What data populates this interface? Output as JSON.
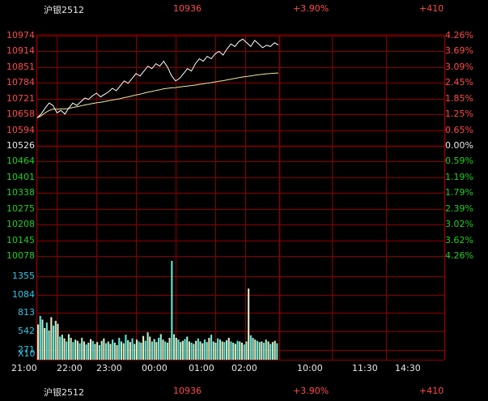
{
  "header_top": {
    "symbol": "沪银2512",
    "price": "10936",
    "change_pct": "+3.90%",
    "change_abs": "+410"
  },
  "header_bottom": {
    "symbol": "沪银2512",
    "price": "10936",
    "change_pct": "+3.90%",
    "change_abs": "+410"
  },
  "price_axis_left": [
    "10974",
    "10914",
    "10851",
    "10784",
    "10721",
    "10658",
    "10594",
    "10526",
    "10464",
    "10401",
    "10338",
    "10275",
    "10208",
    "10145",
    "10078"
  ],
  "price_axis_right": [
    "4.26%",
    "3.69%",
    "3.09%",
    "2.45%",
    "1.85%",
    "1.25%",
    "0.65%",
    "0.00%",
    "0.59%",
    "1.19%",
    "1.79%",
    "2.39%",
    "3.02%",
    "3.62%",
    "4.26%"
  ],
  "volume_axis": [
    "1355",
    "1084",
    "813",
    "542",
    "271"
  ],
  "volume_unit": "X10",
  "time_axis": [
    "21:00",
    "22:00",
    "23:00",
    "00:00",
    "01:00",
    "02:00",
    "10:00",
    "11:30",
    "14:30"
  ],
  "colors": {
    "background": "#000000",
    "grid": "#8b0000",
    "up": "#ff4b4b",
    "down": "#20d020",
    "neutral": "#e8e8e8",
    "volume_axis": "#2ec8e8",
    "price_line": "#ffffff",
    "avg_line": "#f0e6a0"
  },
  "chart_data": {
    "type": "line",
    "base_price": 10526,
    "ylim": [
      10078,
      10974
    ],
    "price_series": {
      "values": [
        10640,
        10655,
        10680,
        10700,
        10690,
        10660,
        10670,
        10655,
        10680,
        10700,
        10690,
        10705,
        10720,
        10715,
        10730,
        10740,
        10725,
        10735,
        10745,
        10760,
        10750,
        10770,
        10790,
        10780,
        10800,
        10820,
        10810,
        10830,
        10850,
        10840,
        10860,
        10850,
        10870,
        10845,
        10810,
        10790,
        10800,
        10820,
        10840,
        10830,
        10860,
        10880,
        10870,
        10890,
        10880,
        10900,
        10910,
        10895,
        10920,
        10940,
        10930,
        10950,
        10960,
        10945,
        10930,
        10955,
        10940,
        10925,
        10935,
        10930,
        10945,
        10936
      ]
    },
    "avg_series": {
      "values": [
        10640,
        10648,
        10660,
        10670,
        10675,
        10675,
        10676,
        10676,
        10678,
        10682,
        10685,
        10688,
        10692,
        10695,
        10698,
        10701,
        10703,
        10706,
        10709,
        10712,
        10715,
        10718,
        10722,
        10725,
        10729,
        10733,
        10736,
        10740,
        10744,
        10747,
        10751,
        10754,
        10758,
        10760,
        10762,
        10763,
        10765,
        10767,
        10769,
        10771,
        10773,
        10776,
        10778,
        10781,
        10783,
        10786,
        10789,
        10791,
        10794,
        10797,
        10800,
        10803,
        10806,
        10808,
        10810,
        10813,
        10815,
        10817,
        10819,
        10820,
        10821,
        10822
      ]
    },
    "volume_series": {
      "values": [
        580,
        720,
        660,
        520,
        610,
        480,
        700,
        560,
        640,
        590,
        380,
        410,
        350,
        300,
        420,
        360,
        290,
        330,
        310,
        270,
        360,
        300,
        250,
        280,
        340,
        310,
        260,
        290,
        240,
        310,
        350,
        270,
        300,
        260,
        330,
        280,
        240,
        360,
        300,
        270,
        410,
        320,
        290,
        350,
        260,
        330,
        300,
        280,
        390,
        310,
        450,
        380,
        300,
        340,
        290,
        360,
        420,
        330,
        300,
        280,
        360,
        1650,
        420,
        360,
        330,
        290,
        310,
        340,
        380,
        300,
        280,
        260,
        310,
        350,
        300,
        270,
        330,
        290,
        360,
        410,
        300,
        280,
        350,
        330,
        300,
        290,
        320,
        360,
        300,
        280,
        260,
        310,
        300,
        280,
        250,
        300,
        1170,
        400,
        360,
        330,
        310,
        290,
        300,
        280,
        330,
        300,
        260,
        290,
        310,
        270
      ]
    },
    "time_labels": [
      "21:00",
      "22:00",
      "23:00",
      "00:00",
      "01:00",
      "02:00",
      "10:00",
      "11:30",
      "14:30"
    ]
  }
}
